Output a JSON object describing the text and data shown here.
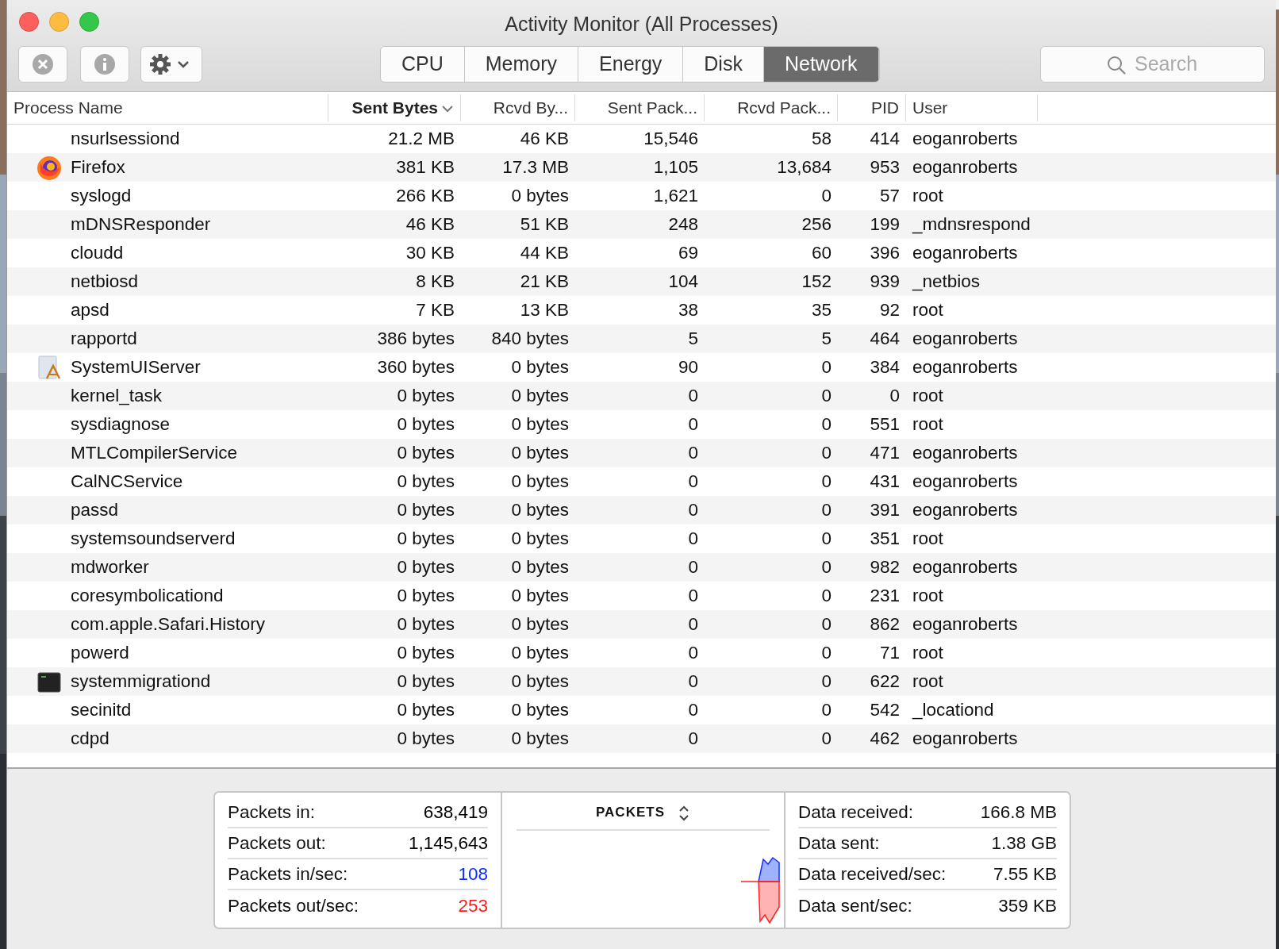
{
  "window": {
    "title": "Activity Monitor (All Processes)"
  },
  "toolbar": {
    "buttons": [
      {
        "kind": "stop"
      },
      {
        "kind": "info"
      },
      {
        "kind": "gear"
      }
    ],
    "tabs": [
      {
        "label": "CPU",
        "selected": false
      },
      {
        "label": "Memory",
        "selected": false
      },
      {
        "label": "Energy",
        "selected": false
      },
      {
        "label": "Disk",
        "selected": false
      },
      {
        "label": "Network",
        "selected": true
      }
    ],
    "search": {
      "placeholder": "Search"
    }
  },
  "table": {
    "columns": [
      {
        "label": "Process Name",
        "sorted": false
      },
      {
        "label": "Sent Bytes",
        "sorted": true
      },
      {
        "label": "Rcvd By...",
        "sorted": false
      },
      {
        "label": "Sent Pack...",
        "sorted": false
      },
      {
        "label": "Rcvd Pack...",
        "sorted": false
      },
      {
        "label": "PID",
        "sorted": false
      },
      {
        "label": "User",
        "sorted": false
      }
    ],
    "rows": [
      {
        "kind": "plain",
        "cells": [
          "nsurlsessiond",
          "21.2 MB",
          "46 KB",
          "15,546",
          "58",
          "414",
          "eoganroberts"
        ]
      },
      {
        "kind": "firefox",
        "cells": [
          "Firefox",
          "381 KB",
          "17.3 MB",
          "1,105",
          "13,684",
          "953",
          "eoganroberts"
        ]
      },
      {
        "kind": "plain",
        "cells": [
          "syslogd",
          "266 KB",
          "0 bytes",
          "1,621",
          "0",
          "57",
          "root"
        ]
      },
      {
        "kind": "plain",
        "cells": [
          "mDNSResponder",
          "46 KB",
          "51 KB",
          "248",
          "256",
          "199",
          "_mdnsrespond"
        ]
      },
      {
        "kind": "plain",
        "cells": [
          "cloudd",
          "30 KB",
          "44 KB",
          "69",
          "60",
          "396",
          "eoganroberts"
        ]
      },
      {
        "kind": "plain",
        "cells": [
          "netbiosd",
          "8 KB",
          "21 KB",
          "104",
          "152",
          "939",
          "_netbios"
        ]
      },
      {
        "kind": "plain",
        "cells": [
          "apsd",
          "7 KB",
          "13 KB",
          "38",
          "35",
          "92",
          "root"
        ]
      },
      {
        "kind": "plain",
        "cells": [
          "rapportd",
          "386 bytes",
          "840 bytes",
          "5",
          "5",
          "464",
          "eoganroberts"
        ]
      },
      {
        "kind": "app",
        "cells": [
          "SystemUIServer",
          "360 bytes",
          "0 bytes",
          "90",
          "0",
          "384",
          "eoganroberts"
        ]
      },
      {
        "kind": "plain",
        "cells": [
          "kernel_task",
          "0 bytes",
          "0 bytes",
          "0",
          "0",
          "0",
          "root"
        ]
      },
      {
        "kind": "plain",
        "cells": [
          "sysdiagnose",
          "0 bytes",
          "0 bytes",
          "0",
          "0",
          "551",
          "root"
        ]
      },
      {
        "kind": "plain",
        "cells": [
          "MTLCompilerService",
          "0 bytes",
          "0 bytes",
          "0",
          "0",
          "471",
          "eoganroberts"
        ]
      },
      {
        "kind": "plain",
        "cells": [
          "CalNCService",
          "0 bytes",
          "0 bytes",
          "0",
          "0",
          "431",
          "eoganroberts"
        ]
      },
      {
        "kind": "plain",
        "cells": [
          "passd",
          "0 bytes",
          "0 bytes",
          "0",
          "0",
          "391",
          "eoganroberts"
        ]
      },
      {
        "kind": "plain",
        "cells": [
          "systemsoundserverd",
          "0 bytes",
          "0 bytes",
          "0",
          "0",
          "351",
          "root"
        ]
      },
      {
        "kind": "plain",
        "cells": [
          "mdworker",
          "0 bytes",
          "0 bytes",
          "0",
          "0",
          "982",
          "eoganroberts"
        ]
      },
      {
        "kind": "plain",
        "cells": [
          "coresymbolicationd",
          "0 bytes",
          "0 bytes",
          "0",
          "0",
          "231",
          "root"
        ]
      },
      {
        "kind": "plain",
        "cells": [
          "com.apple.Safari.History",
          "0 bytes",
          "0 bytes",
          "0",
          "0",
          "862",
          "eoganroberts"
        ]
      },
      {
        "kind": "plain",
        "cells": [
          "powerd",
          "0 bytes",
          "0 bytes",
          "0",
          "0",
          "71",
          "root"
        ]
      },
      {
        "kind": "terminal",
        "cells": [
          "systemmigrationd",
          "0 bytes",
          "0 bytes",
          "0",
          "0",
          "622",
          "root"
        ]
      },
      {
        "kind": "plain",
        "cells": [
          "secinitd",
          "0 bytes",
          "0 bytes",
          "0",
          "0",
          "542",
          "_locationd"
        ]
      },
      {
        "kind": "plain",
        "cells": [
          "cdpd",
          "0 bytes",
          "0 bytes",
          "0",
          "0",
          "462",
          "eoganroberts"
        ]
      }
    ]
  },
  "summary": {
    "left": [
      {
        "label": "Packets in:",
        "value": "638,419",
        "color": "#000000"
      },
      {
        "label": "Packets out:",
        "value": "1,145,643",
        "color": "#000000"
      },
      {
        "label": "Packets in/sec:",
        "value": "108",
        "color": "#0a2cff"
      },
      {
        "label": "Packets out/sec:",
        "value": "253",
        "color": "#ff1a1a"
      }
    ],
    "graph_title": "PACKETS",
    "right": [
      {
        "label": "Data received:",
        "value": "166.8 MB"
      },
      {
        "label": "Data sent:",
        "value": "1.38 GB"
      },
      {
        "label": "Data received/sec:",
        "value": "7.55 KB"
      },
      {
        "label": "Data sent/sec:",
        "value": "359 KB"
      }
    ]
  }
}
